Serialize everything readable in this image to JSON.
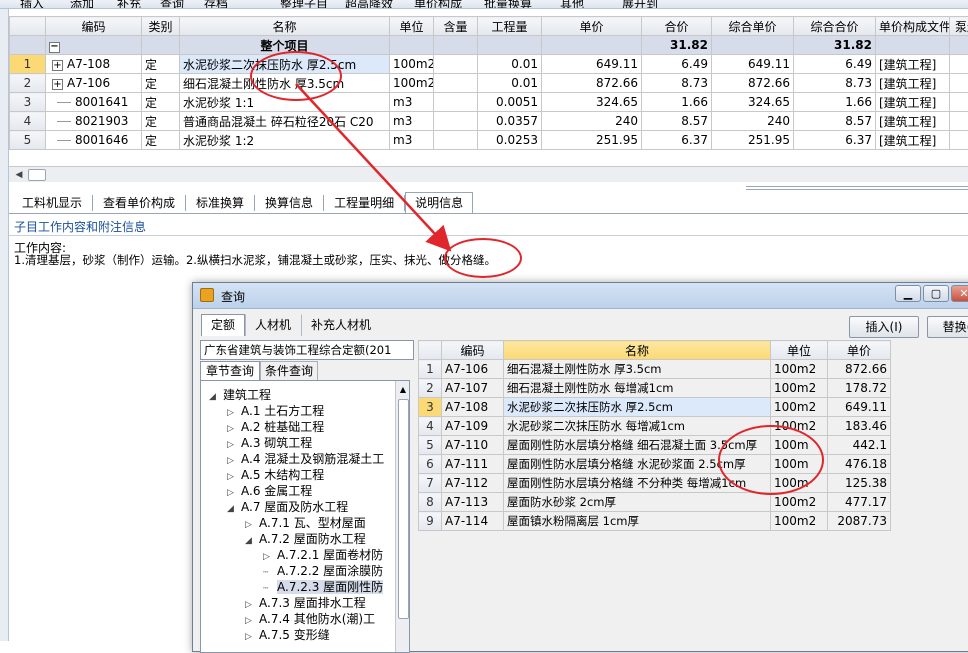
{
  "toolbar": {
    "items": [
      "插入",
      "添加",
      "补充",
      "查询",
      "存档",
      "整理子目",
      "超高降效",
      "单价构成",
      "批量换算",
      "其他",
      "展开到"
    ]
  },
  "main_grid": {
    "columns": [
      "编码",
      "类别",
      "名称",
      "单位",
      "含量",
      "工程量",
      "单价",
      "合价",
      "综合单价",
      "综合合价",
      "单价构成文件",
      "泵送"
    ],
    "total": {
      "name": "整个项目",
      "hejia": "31.82",
      "zonghe_hejia": "31.82"
    },
    "rows": [
      {
        "idx": "1",
        "code": "A7-108",
        "type": "定",
        "name": "水泥砂浆二次抹压防水 厚2.5cm",
        "unit": "100m2",
        "content": "",
        "qty": "0.01",
        "price": "649.11",
        "total": "6.49",
        "comp_price": "649.11",
        "comp_total": "6.49",
        "file": "[建筑工程]"
      },
      {
        "idx": "2",
        "code": "A7-106",
        "type": "定",
        "name": "细石混凝土刚性防水 厚3.5cm",
        "unit": "100m2",
        "content": "",
        "qty": "0.01",
        "price": "872.66",
        "total": "8.73",
        "comp_price": "872.66",
        "comp_total": "8.73",
        "file": "[建筑工程]"
      },
      {
        "idx": "3",
        "code": "8001641",
        "type": "定",
        "name": "水泥砂浆 1:1",
        "unit": "m3",
        "content": "",
        "qty": "0.0051",
        "price": "324.65",
        "total": "1.66",
        "comp_price": "324.65",
        "comp_total": "1.66",
        "file": "[建筑工程]"
      },
      {
        "idx": "4",
        "code": "8021903",
        "type": "定",
        "name": "普通商品混凝土 碎石粒径20石 C20",
        "unit": "m3",
        "content": "",
        "qty": "0.0357",
        "price": "240",
        "total": "8.57",
        "comp_price": "240",
        "comp_total": "8.57",
        "file": "[建筑工程]"
      },
      {
        "idx": "5",
        "code": "8001646",
        "type": "定",
        "name": "水泥砂浆 1:2",
        "unit": "m3",
        "content": "",
        "qty": "0.0253",
        "price": "251.95",
        "total": "6.37",
        "comp_price": "251.95",
        "comp_total": "6.37",
        "file": "[建筑工程]"
      }
    ]
  },
  "bottom_tabs": [
    "工料机显示",
    "查看单价构成",
    "标准换算",
    "换算信息",
    "工程量明细",
    "说明信息"
  ],
  "info": {
    "section_title": "子目工作内容和附注信息",
    "label": "工作内容:",
    "text": "1.清理基层，砂浆（制作）运输。2.纵横扫水泥浆，铺混凝土或砂浆，压实、抹光、做分格缝。"
  },
  "dialog": {
    "title": "查询",
    "tabs": [
      "定额",
      "人材机",
      "补充人材机"
    ],
    "insert_button": "插入(I)",
    "replace_button": "替换(",
    "library_select": "广东省建筑与装饰工程综合定额(201",
    "subtabs": [
      "章节查询",
      "条件查询"
    ],
    "tree": [
      {
        "label": "建筑工程",
        "level": 0,
        "toggle": "◢"
      },
      {
        "label": "A.1 土石方工程",
        "level": 1,
        "toggle": "▷"
      },
      {
        "label": "A.2 桩基础工程",
        "level": 1,
        "toggle": "▷"
      },
      {
        "label": "A.3 砌筑工程",
        "level": 1,
        "toggle": "▷"
      },
      {
        "label": "A.4 混凝土及钢筋混凝土工",
        "level": 1,
        "toggle": "▷"
      },
      {
        "label": "A.5 木结构工程",
        "level": 1,
        "toggle": "▷"
      },
      {
        "label": "A.6 金属工程",
        "level": 1,
        "toggle": "▷"
      },
      {
        "label": "A.7 屋面及防水工程",
        "level": 1,
        "toggle": "◢"
      },
      {
        "label": "A.7.1 瓦、型材屋面",
        "level": 2,
        "toggle": "▷"
      },
      {
        "label": "A.7.2 屋面防水工程",
        "level": 2,
        "toggle": "◢"
      },
      {
        "label": "A.7.2.1 屋面卷材防",
        "level": 3,
        "toggle": "▷"
      },
      {
        "label": "A.7.2.2 屋面涂膜防",
        "level": 3,
        "toggle": ""
      },
      {
        "label": "A.7.2.3 屋面刚性防",
        "level": 3,
        "toggle": ""
      },
      {
        "label": "A.7.3 屋面排水工程",
        "level": 2,
        "toggle": "▷"
      },
      {
        "label": "A.7.4 其他防水(潮)工",
        "level": 2,
        "toggle": "▷"
      },
      {
        "label": "A.7.5 变形缝",
        "level": 2,
        "toggle": "▷"
      }
    ],
    "columns": [
      "编码",
      "名称",
      "单位",
      "单价"
    ],
    "rows": [
      {
        "idx": "1",
        "code": "A7-106",
        "name": "细石混凝土刚性防水 厚3.5cm",
        "unit": "100m2",
        "price": "872.66"
      },
      {
        "idx": "2",
        "code": "A7-107",
        "name": "细石混凝土刚性防水 每增减1cm",
        "unit": "100m2",
        "price": "178.72"
      },
      {
        "idx": "3",
        "code": "A7-108",
        "name": "水泥砂浆二次抹压防水 厚2.5cm",
        "unit": "100m2",
        "price": "649.11"
      },
      {
        "idx": "4",
        "code": "A7-109",
        "name": "水泥砂浆二次抹压防水 每增减1cm",
        "unit": "100m2",
        "price": "183.46"
      },
      {
        "idx": "5",
        "code": "A7-110",
        "name": "屋面刚性防水层填分格缝 细石混凝土面 3.5cm厚",
        "unit": "100m",
        "price": "442.1"
      },
      {
        "idx": "6",
        "code": "A7-111",
        "name": "屋面刚性防水层填分格缝 水泥砂浆面 2.5cm厚",
        "unit": "100m",
        "price": "476.18"
      },
      {
        "idx": "7",
        "code": "A7-112",
        "name": "屋面刚性防水层填分格缝 不分种类 每增减1cm",
        "unit": "100m",
        "price": "125.38"
      },
      {
        "idx": "8",
        "code": "A7-113",
        "name": "屋面防水砂浆 2cm厚",
        "unit": "100m2",
        "price": "477.17"
      },
      {
        "idx": "9",
        "code": "A7-114",
        "name": "屋面镇水粉隔离层 1cm厚",
        "unit": "100m2",
        "price": "2087.73"
      }
    ]
  },
  "colors": {
    "annotation": "#e0262b",
    "selection": "#fbd974",
    "header": "#e4e8ee"
  }
}
